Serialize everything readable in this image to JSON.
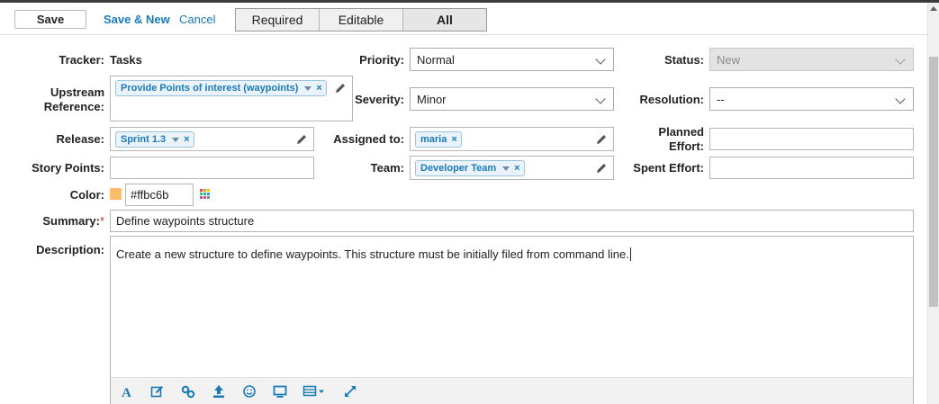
{
  "toolbar": {
    "save_label": "Save",
    "save_new_label": "Save & New",
    "cancel_label": "Cancel",
    "filters": [
      {
        "label": "Required",
        "active": false
      },
      {
        "label": "Editable",
        "active": false
      },
      {
        "label": "All",
        "active": true
      }
    ]
  },
  "fields": {
    "tracker": {
      "label": "Tracker:",
      "value": "Tasks"
    },
    "upstream": {
      "label_line1": "Upstream",
      "label_line2": "Reference:",
      "chip": "Provide Points of interest (waypoints)"
    },
    "release": {
      "label": "Release:",
      "chip": "Sprint 1.3"
    },
    "story_points": {
      "label": "Story Points:",
      "value": ""
    },
    "color": {
      "label": "Color:",
      "value": "#ffbc6b",
      "swatch": "#ffbc6b"
    },
    "summary": {
      "label": "Summary:",
      "required_mark": "*",
      "value": "Define waypoints structure"
    },
    "description": {
      "label": "Description:",
      "value": "Create a new structure to define waypoints. This structure must be initially filed from command line."
    },
    "priority": {
      "label": "Priority:",
      "value": "Normal"
    },
    "severity": {
      "label": "Severity:",
      "value": "Minor"
    },
    "assigned_to": {
      "label": "Assigned to:",
      "chip": "maria"
    },
    "team": {
      "label": "Team:",
      "chip": "Developer Team"
    },
    "status": {
      "label": "Status:",
      "value": "New"
    },
    "resolution": {
      "label": "Resolution:",
      "value": "--"
    },
    "planned_effort": {
      "label_line1": "Planned",
      "label_line2": "Effort:",
      "value": ""
    },
    "spent_effort": {
      "label": "Spent Effort:",
      "value": ""
    }
  },
  "chip_remove_glyph": "×",
  "editor_toolbar_icons": [
    "font-icon",
    "edit-icon",
    "link-icon",
    "upload-icon",
    "emoji-icon",
    "monitor-icon",
    "table-icon",
    "expand-icon"
  ],
  "colors": {
    "accent": "#1a7ab8",
    "chip_bg": "#eaf3fa",
    "required": "#c0392b"
  }
}
